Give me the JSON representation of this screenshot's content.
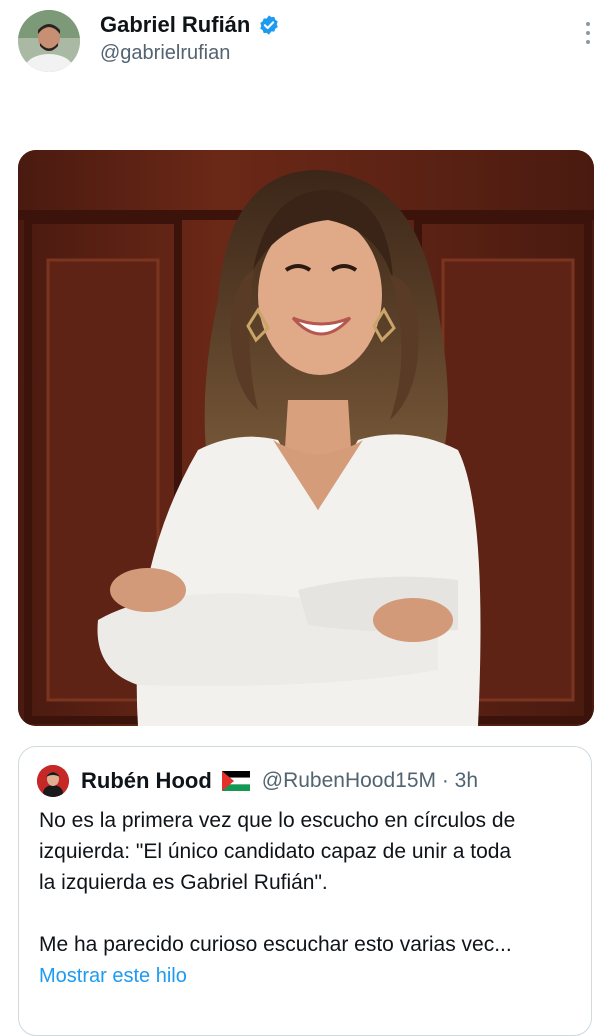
{
  "author": {
    "name": "Gabriel Rufián",
    "handle": "@gabrielrufian",
    "verified": true,
    "verified_color": "#1d9bf0"
  },
  "media": {
    "photo_icon": "portrait-photo-of-smiling-woman-in-white-sweater"
  },
  "quoted_tweet": {
    "author_name": "Rubén Hood",
    "flag_icon": "palestine-flag-icon",
    "handle_time": "@RubenHood15M · 3h",
    "text": "No es la primera vez que lo escucho en círculos de\nizquierda: \"El único candidato capaz de unir a toda\nla izquierda es Gabriel Rufián\".\n\nMe ha parecido curioso escuchar esto varias vec...",
    "show_thread_label": "Mostrar este hilo"
  },
  "colors": {
    "text": "#0f1419",
    "secondary": "#536471",
    "link": "#1d9bf0",
    "border": "#cfd9de"
  }
}
